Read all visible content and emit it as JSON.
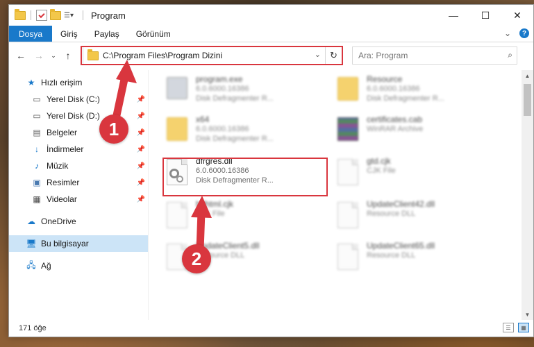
{
  "window": {
    "title": "Program",
    "controls": {
      "minimize": "—",
      "maximize": "☐",
      "close": "✕"
    }
  },
  "ribbon": {
    "tabs": [
      "Dosya",
      "Giriş",
      "Paylaş",
      "Görünüm"
    ],
    "expand_icon": "⌄",
    "help_icon": "?"
  },
  "address": {
    "path": "C:\\Program Files\\Program Dizini",
    "search_placeholder": "Ara: Program"
  },
  "sidebar": {
    "items": [
      {
        "label": "Hızlı erişim",
        "icon": "star-icon"
      },
      {
        "label": "Yerel Disk (C:)",
        "icon": "drive-icon",
        "pinned": true
      },
      {
        "label": "Yerel Disk (D:)",
        "icon": "drive-icon",
        "pinned": true
      },
      {
        "label": "Belgeler",
        "icon": "documents-icon",
        "pinned": true
      },
      {
        "label": "İndirmeler",
        "icon": "download-icon",
        "pinned": true
      },
      {
        "label": "Müzik",
        "icon": "music-icon",
        "pinned": true
      },
      {
        "label": "Resimler",
        "icon": "pictures-icon",
        "pinned": true
      },
      {
        "label": "Videolar",
        "icon": "videos-icon",
        "pinned": true
      },
      {
        "label": "OneDrive",
        "icon": "cloud-icon"
      },
      {
        "label": "Bu bilgisayar",
        "icon": "computer-icon",
        "active": true
      },
      {
        "label": "Ağ",
        "icon": "network-icon"
      }
    ]
  },
  "files": [
    {
      "name": "program.exe",
      "line2": "6.0.6000.16386",
      "line3": "Disk Defragmenter R...",
      "icon": "exe-icon"
    },
    {
      "name": "Resource",
      "line2": "6.0.6000.16386",
      "line3": "Disk Defragmenter R...",
      "icon": "folder-icon"
    },
    {
      "name": "x64",
      "line2": "6.0.6000.16386",
      "line3": "Disk Defragmenter R...",
      "icon": "folder-icon"
    },
    {
      "name": "certificates.cab",
      "line2": "WinRAR Archive",
      "line3": "",
      "icon": "archive-icon"
    },
    {
      "name": "dfrgres.dll",
      "line2": "6.0.6000.16386",
      "line3": "Disk Defragmenter R...",
      "icon": "dll-icon"
    },
    {
      "name": "gtd.cjk",
      "line2": "CJK File",
      "line3": "",
      "icon": "file-icon"
    },
    {
      "name": "hdhtml.cjk",
      "line2": "CJK File",
      "line3": "",
      "icon": "file-icon"
    },
    {
      "name": "UpdateClient42.dll",
      "line2": "Resource DLL",
      "line3": "",
      "icon": "dll-icon"
    },
    {
      "name": "UpdateClient5.dll",
      "line2": "Resource DLL",
      "line3": "",
      "icon": "dll-icon"
    },
    {
      "name": "UpdateClient65.dll",
      "line2": "Resource DLL",
      "line3": "",
      "icon": "dll-icon"
    }
  ],
  "status": {
    "item_count": "171 öğe"
  },
  "annotations": {
    "step1": "1",
    "step2": "2",
    "color": "#d9363e"
  }
}
